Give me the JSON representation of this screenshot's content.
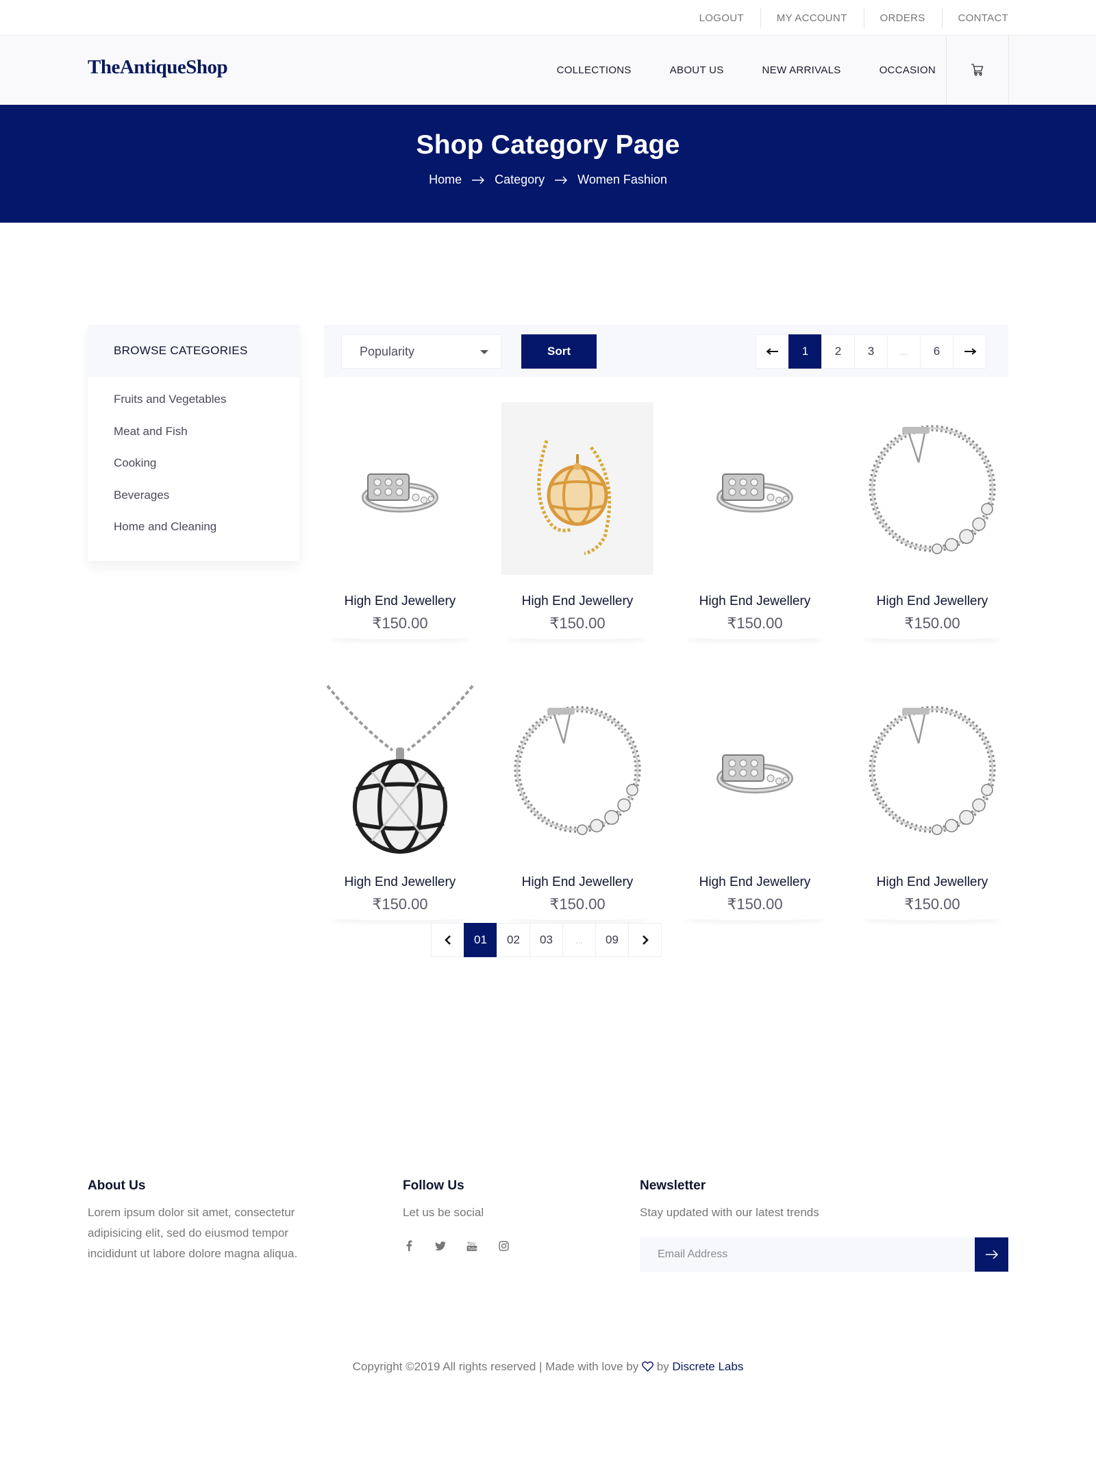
{
  "topbar": {
    "links": [
      "LOGOUT",
      "MY ACCOUNT",
      "ORDERS",
      "CONTACT"
    ]
  },
  "header": {
    "logo": "TheAntiqueShop",
    "nav": [
      "COLLECTIONS",
      "ABOUT US",
      "NEW ARRIVALS",
      "OCCASION"
    ],
    "cart_icon": "cart-icon"
  },
  "banner": {
    "title": "Shop Category Page",
    "breadcrumb": [
      "Home",
      "Category",
      "Women Fashion"
    ]
  },
  "sidebar": {
    "title": "BROWSE CATEGORIES",
    "items": [
      "Fruits and Vegetables",
      "Meat and Fish",
      "Cooking",
      "Beverages",
      "Home and Cleaning"
    ]
  },
  "filter": {
    "sort_select": "Popularity",
    "sort_button": "Sort",
    "pages": [
      "1",
      "2",
      "3",
      "...",
      "6"
    ],
    "current_page": "1"
  },
  "products": [
    {
      "name": "High End Jewellery",
      "price": "₹150.00",
      "image": "ring"
    },
    {
      "name": "High End Jewellery",
      "price": "₹150.00",
      "image": "gold-pendant"
    },
    {
      "name": "High End Jewellery",
      "price": "₹150.00",
      "image": "ring"
    },
    {
      "name": "High End Jewellery",
      "price": "₹150.00",
      "image": "bracelet"
    },
    {
      "name": "High End Jewellery",
      "price": "₹150.00",
      "image": "silver-pendant"
    },
    {
      "name": "High End Jewellery",
      "price": "₹150.00",
      "image": "bracelet"
    },
    {
      "name": "High End Jewellery",
      "price": "₹150.00",
      "image": "ring"
    },
    {
      "name": "High End Jewellery",
      "price": "₹150.00",
      "image": "bracelet"
    }
  ],
  "pagination": {
    "pages": [
      "01",
      "02",
      "03",
      "...",
      "09"
    ],
    "current": "01"
  },
  "footer": {
    "about": {
      "title": "About Us",
      "text": "Lorem ipsum dolor sit amet, consectetur adipisicing elit, sed do eiusmod tempor incididunt ut labore dolore magna aliqua."
    },
    "follow": {
      "title": "Follow Us",
      "text": "Let us be social",
      "icons": [
        "facebook-icon",
        "twitter-icon",
        "youtube-icon",
        "instagram-icon"
      ]
    },
    "newsletter": {
      "title": "Newsletter",
      "text": "Stay updated with our latest trends",
      "placeholder": "Email Address"
    },
    "copyright_prefix": "Copyright ©2019 All rights reserved | Made with love by",
    "copyright_by": "by",
    "copyright_link": "Discrete Labs"
  },
  "colors": {
    "brand": "#04176a",
    "light_bg": "#f7f8fc"
  }
}
